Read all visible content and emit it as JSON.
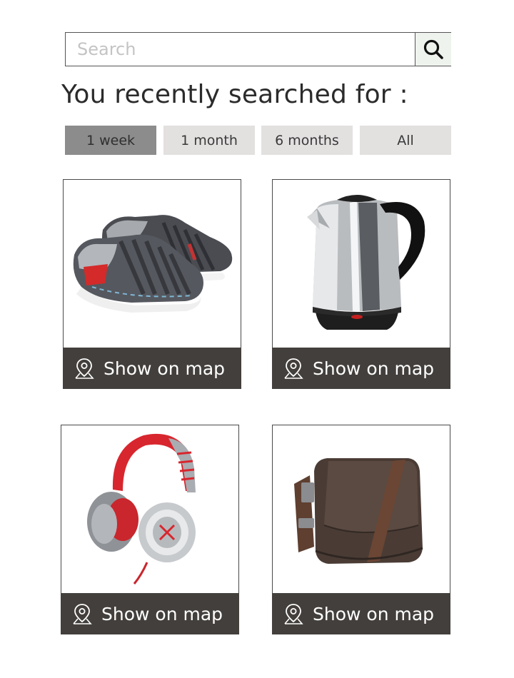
{
  "search": {
    "placeholder": "Search",
    "value": ""
  },
  "heading": "You recently searched for :",
  "tabs": [
    {
      "label": "1 week",
      "active": true
    },
    {
      "label": "1 month",
      "active": false
    },
    {
      "label": "6 months",
      "active": false
    },
    {
      "label": "All",
      "active": false
    }
  ],
  "results": [
    {
      "image": "sneakers",
      "action_label": "Show on map"
    },
    {
      "image": "electric-kettle",
      "action_label": "Show on map"
    },
    {
      "image": "headphones",
      "action_label": "Show on map"
    },
    {
      "image": "messenger-bag",
      "action_label": "Show on map"
    }
  ],
  "colors": {
    "active_tab": "#8c8c8c",
    "inactive_tab": "#e3e0e0",
    "map_bar": "#433f3c",
    "search_button": "#eef3ee"
  },
  "icons": {
    "search": "search-icon",
    "map_pin": "map-pin-icon"
  }
}
